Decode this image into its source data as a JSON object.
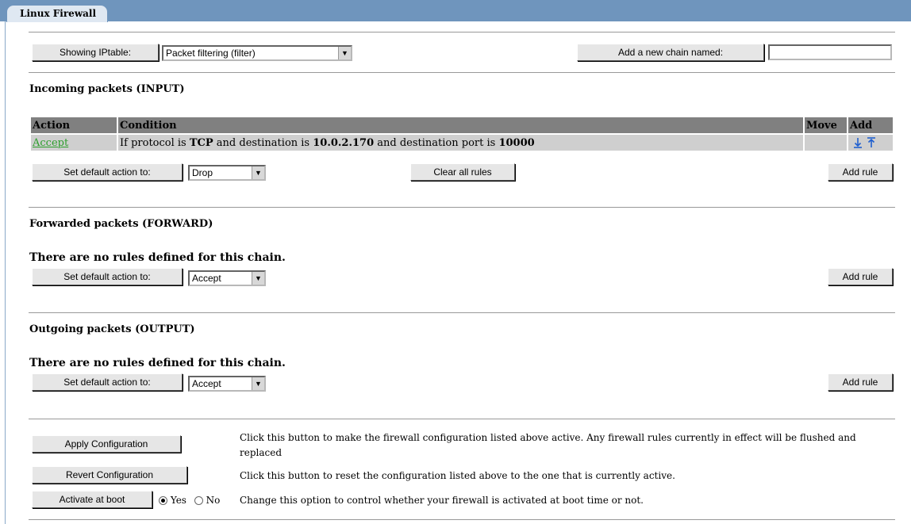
{
  "tab": {
    "title": "Linux Firewall"
  },
  "top": {
    "showing_label": "Showing IPtable:",
    "iptable_selected": "Packet filtering (filter)",
    "add_chain_label": "Add a new chain named:",
    "chain_name_value": ""
  },
  "input": {
    "heading": "Incoming packets (INPUT)",
    "columns": {
      "action": "Action",
      "condition": "Condition",
      "move": "Move",
      "add": "Add"
    },
    "rule": {
      "action": "Accept",
      "c1": "If protocol is ",
      "proto": "TCP",
      "c2": " and destination is ",
      "dest": "10.0.2.170",
      "c3": " and destination port is ",
      "port": "10000"
    },
    "default_label": "Set default action to:",
    "default_value": "Drop",
    "clear_label": "Clear all rules",
    "add_rule_label": "Add rule"
  },
  "forward": {
    "heading": "Forwarded packets (FORWARD)",
    "no_rules": "There are no rules defined for this chain.",
    "default_label": "Set default action to:",
    "default_value": "Accept",
    "add_rule_label": "Add rule"
  },
  "output": {
    "heading": "Outgoing packets (OUTPUT)",
    "no_rules": "There are no rules defined for this chain.",
    "default_label": "Set default action to:",
    "default_value": "Accept",
    "add_rule_label": "Add rule"
  },
  "bottom": {
    "apply_label": "Apply Configuration",
    "apply_desc": "Click this button to make the firewall configuration listed above active. Any firewall rules currently in effect will be flushed and replaced",
    "revert_label": "Revert Configuration",
    "revert_desc": "Click this button to reset the configuration listed above to the one that is currently active.",
    "boot_label": "Activate at boot",
    "yes_label": "Yes",
    "no_label": "No",
    "boot_selected": "Yes",
    "boot_desc": "Change this option to control whether your firewall is activated at boot time or not."
  },
  "colors": {
    "tabbar": "#6f95bd",
    "header_cell": "#808080",
    "row_cell": "#cfcfcf",
    "link_green": "#2b9e2b",
    "icon_blue": "#1f5fcf"
  }
}
